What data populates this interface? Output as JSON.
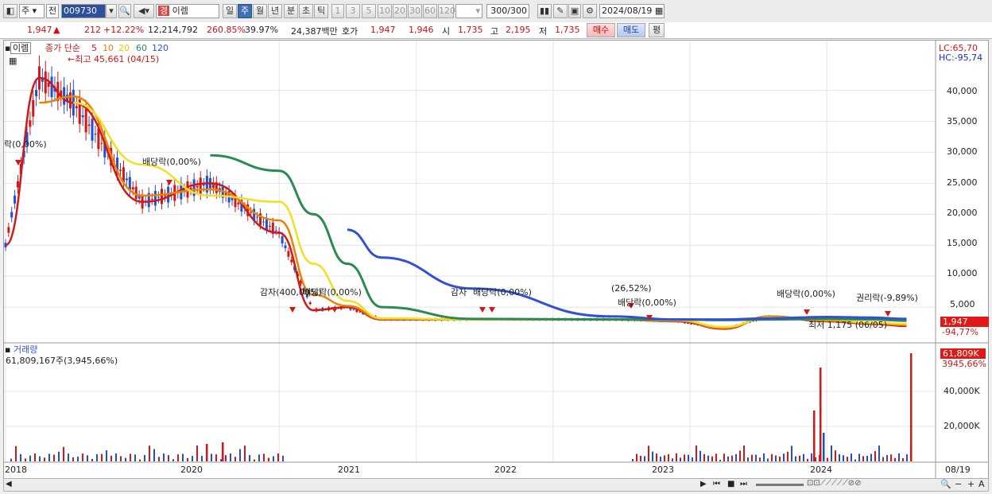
{
  "toolbar": {
    "period_type": "주",
    "prev_label": "전",
    "code": "009730",
    "name": "이렘",
    "name_badge": "경",
    "intervals": [
      "일",
      "주",
      "월",
      "년",
      "분",
      "초",
      "틱"
    ],
    "active_interval": "주",
    "numbers": [
      "1",
      "3",
      "5",
      "10",
      "20",
      "30",
      "60",
      "120"
    ],
    "count": "300",
    "count_total": "/300",
    "date": "2024/08/19"
  },
  "quote": {
    "price": "1,947",
    "arrow": "▲",
    "change": "212",
    "change_pct": "+12.22%",
    "volume": "12,214,792",
    "vol_ratio": "260.85%",
    "turnover": "39.97%",
    "amount": "24,387백만",
    "hoga_label": "호가",
    "ask": "1,947",
    "bid": "1,946",
    "open_label": "시",
    "open": "1,735",
    "high_label": "고",
    "high": "2,195",
    "low_label": "저",
    "low": "1,735",
    "buy_label": "매수",
    "sell_label": "매도",
    "eval_label": "평"
  },
  "chart": {
    "stock_name": "이렘",
    "ma_title": "종가 단순",
    "ma_periods": [
      "5",
      "10",
      "20",
      "60",
      "120"
    ],
    "ma_colors": [
      "#d01818",
      "#f08000",
      "#f0e020",
      "#2a8a50",
      "#3050d8"
    ],
    "high_note": "최고 45,661 (04/15)",
    "low_note": "최저 1,175 (06/05)",
    "lc": "LC:65,70",
    "hc": "HC:-95,74",
    "y_ticks": [
      "40,000",
      "35,000",
      "30,000",
      "25,000",
      "20,000",
      "15,000",
      "10,000",
      "5,000"
    ],
    "current_price": "1,947",
    "current_pct": "-94,77%",
    "events": [
      "락(0,00%)",
      "배당락(0,00%)",
      "감자(400,00%)",
      "배당락(0,00%)",
      "감자",
      "배당락(0,00%)",
      "(26,52%)",
      "배당락(0,00%)",
      "배당락(0,00%)",
      "권리락(-9,89%)"
    ],
    "volume_title": "거래량",
    "volume_value": "61,809,167주(3,945,66%)",
    "volume_ticks": [
      "40,000K",
      "20,000K"
    ],
    "volume_current": "61,809K",
    "volume_current_pct": "3945,66%",
    "x_labels": [
      "2018",
      "2020",
      "2021",
      "2022",
      "2023",
      "2024",
      "08/19"
    ]
  },
  "chart_data": {
    "type": "line",
    "title": "",
    "xlabel": "",
    "ylabel": "",
    "x": [
      "2018-01",
      "2018-04",
      "2018-07",
      "2019-01",
      "2019-07",
      "2020-01",
      "2020-04",
      "2020-07",
      "2020-10",
      "2021-06",
      "2022-06",
      "2022-12",
      "2023-04",
      "2023-08",
      "2024-01",
      "2024-05",
      "2024-08"
    ],
    "series": [
      {
        "name": "5",
        "values": [
          15000,
          42000,
          38000,
          22000,
          25000,
          17000,
          4500,
          5000,
          3000,
          3000,
          3000,
          2700,
          1500,
          3500,
          2700,
          2300,
          1950
        ]
      },
      {
        "name": "10",
        "values": [
          null,
          38000,
          39000,
          23000,
          24000,
          19000,
          7000,
          5200,
          3100,
          3000,
          3000,
          2800,
          1600,
          3500,
          2800,
          2400,
          2100
        ]
      },
      {
        "name": "20",
        "values": [
          null,
          null,
          38000,
          28000,
          23000,
          22000,
          12000,
          6000,
          3200,
          3000,
          3000,
          2900,
          1800,
          3300,
          3000,
          2500,
          2300
        ]
      },
      {
        "name": "60",
        "values": [
          null,
          null,
          null,
          null,
          29500,
          27000,
          20000,
          12000,
          5000,
          3100,
          3000,
          3000,
          2900,
          3000,
          3100,
          3000,
          2800
        ]
      },
      {
        "name": "120",
        "values": [
          null,
          null,
          null,
          null,
          null,
          null,
          null,
          17500,
          13000,
          8000,
          3500,
          3000,
          3000,
          3200,
          3400,
          3300,
          3100
        ]
      }
    ],
    "ylim": [
      0,
      47000
    ],
    "grid": true
  }
}
